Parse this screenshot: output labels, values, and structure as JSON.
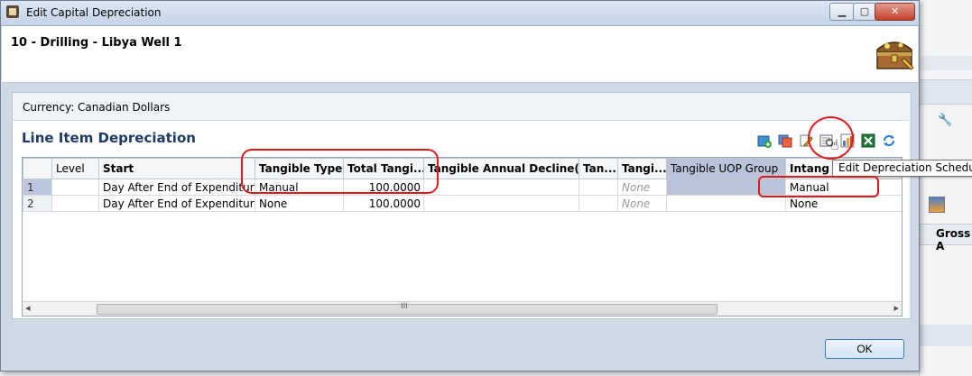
{
  "window": {
    "title": "Edit Capital Depreciation",
    "buttons": {
      "minimize": "▁",
      "maximize": "▢",
      "close": "✕"
    }
  },
  "header": {
    "title": "10 - Drilling - Libya Well 1",
    "icon": "treasure-chest-icon"
  },
  "currency_label": "Currency: Canadian Dollars",
  "section": {
    "title": "Line Item Depreciation"
  },
  "toolbar": {
    "icons": [
      "add-row-icon",
      "copy-icon",
      "edit-icon",
      "edit-depreciation-schedule-icon",
      "chart-icon",
      "excel-export-icon",
      "refresh-icon"
    ]
  },
  "grid": {
    "columns": [
      "",
      "Level",
      "Start",
      "Tangible Type",
      "Total Tangi...",
      "Tangible Annual Decline(%)",
      "Tan...",
      "Tangi...",
      "Tangible UOP Group",
      "Intang"
    ],
    "rows": [
      {
        "num": "1",
        "level": "",
        "start": "Day After End of Expenditure",
        "tangible_type": "Manual",
        "total_tangible": "100.0000",
        "annual_decline": "",
        "tan": "",
        "tangi": "None",
        "uop_group": "",
        "intang": "Manual"
      },
      {
        "num": "2",
        "level": "",
        "start": "Day After End of Expenditure",
        "tangible_type": "None",
        "total_tangible": "100.0000",
        "annual_decline": "",
        "tan": "",
        "tangi": "None",
        "uop_group": "",
        "intang": "None"
      }
    ],
    "scroll_thumb_glyph": "III",
    "scroll_left": "◂",
    "scroll_right": "▸"
  },
  "tooltip": "Edit Depreciation Schedule",
  "ok_label": "OK",
  "background": {
    "column_header": "Gross A"
  },
  "colors": {
    "title_text": "#1f3a66",
    "highlight_ring": "#e01a1a",
    "uop_column": "#b9c4da"
  }
}
